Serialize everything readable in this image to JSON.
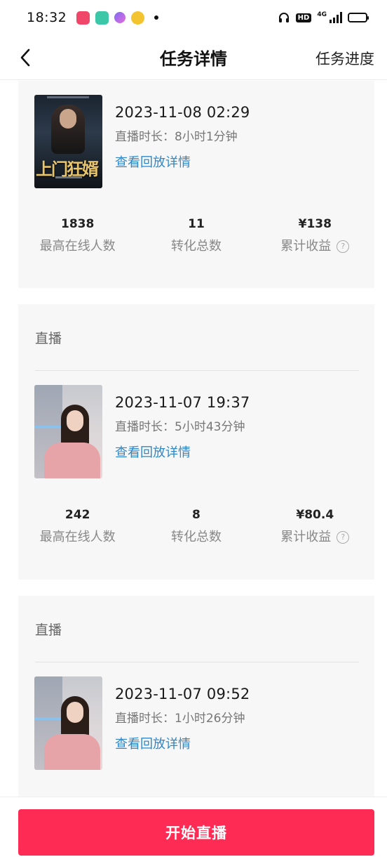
{
  "status_bar": {
    "time": "18:32",
    "network": "4G",
    "hd": "HD"
  },
  "nav": {
    "title": "任务详情",
    "right_action": "任务进度"
  },
  "cards": [
    {
      "header": "",
      "date": "2023-11-08 02:29",
      "duration": "直播时长：8小时1分钟",
      "link": "查看回放详情",
      "cover_title": "上门狂婿",
      "stats": [
        {
          "value": "1838",
          "label": "最高在线人数"
        },
        {
          "value": "11",
          "label": "转化总数"
        },
        {
          "value": "¥138",
          "label": "累计收益"
        }
      ]
    },
    {
      "header": "直播",
      "date": "2023-11-07 19:37",
      "duration": "直播时长：5小时43分钟",
      "link": "查看回放详情",
      "stats": [
        {
          "value": "242",
          "label": "最高在线人数"
        },
        {
          "value": "8",
          "label": "转化总数"
        },
        {
          "value": "¥80.4",
          "label": "累计收益"
        }
      ]
    },
    {
      "header": "直播",
      "date": "2023-11-07 09:52",
      "duration": "直播时长：1小时26分钟",
      "link": "查看回放详情"
    }
  ],
  "help_glyph": "?",
  "bottom": {
    "start_button": "开始直播"
  },
  "colors": {
    "accent": "#fe2c55",
    "link": "#2f87c9",
    "card_bg": "#f7f7f7"
  }
}
